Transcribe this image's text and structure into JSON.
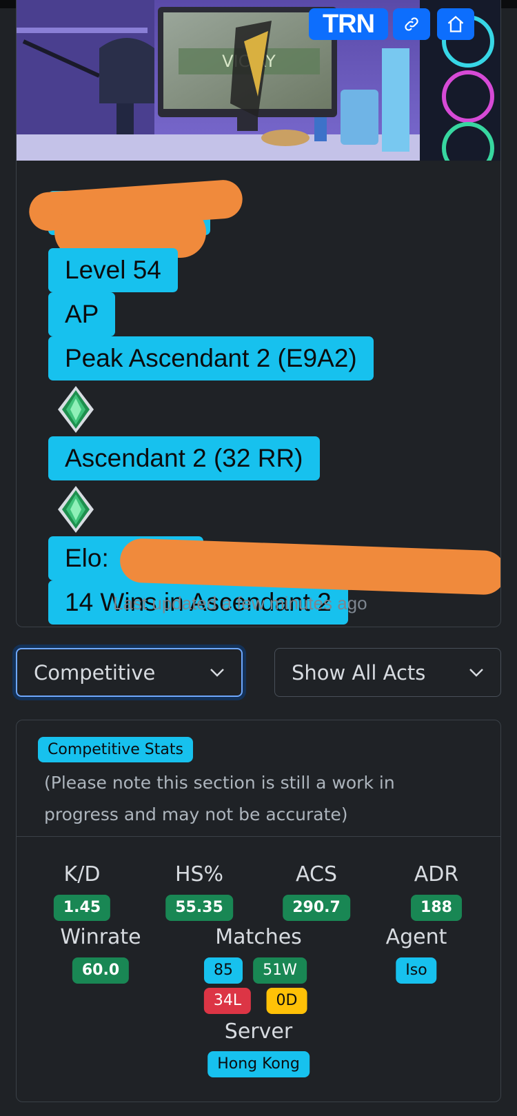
{
  "banner": {
    "monitor_text": "VIC RY",
    "trn_label": "TRN",
    "link_icon": "link-icon",
    "home_icon": "home-icon"
  },
  "profile": {
    "level": "Level 54",
    "region": "AP",
    "peak_rank": "Peak Ascendant 2 (E9A2)",
    "current_rank": "Ascendant 2 (32 RR)",
    "elo_label": "Elo:",
    "wins_text": "14 Wins in Ascendant 2",
    "last_updated": "Last updated a few minutes ago",
    "rank_icon": "ascendant-rank-icon"
  },
  "filters": {
    "mode": "Competitive",
    "acts": "Show All Acts"
  },
  "stats": {
    "section_title": "Competitive Stats",
    "note": "(Please note this section is still a work in progress and may not be accurate)",
    "kd_label": "K/D",
    "kd": "1.45",
    "hs_label": "HS%",
    "hs": "55.35",
    "acs_label": "ACS",
    "acs": "290.7",
    "adr_label": "ADR",
    "adr": "188",
    "winrate_label": "Winrate",
    "winrate": "60.0",
    "matches_label": "Matches",
    "matches": "85",
    "wins": "51W",
    "losses": "34L",
    "draws": "0D",
    "agent_label": "Agent",
    "agent": "Iso",
    "server_label": "Server",
    "server": "Hong Kong"
  },
  "colors": {
    "accent_cyan": "#17c1ee",
    "success": "#198754",
    "danger": "#dc3545",
    "warning": "#ffc107",
    "primary": "#0d6efd",
    "redaction": "#f08a3c"
  }
}
